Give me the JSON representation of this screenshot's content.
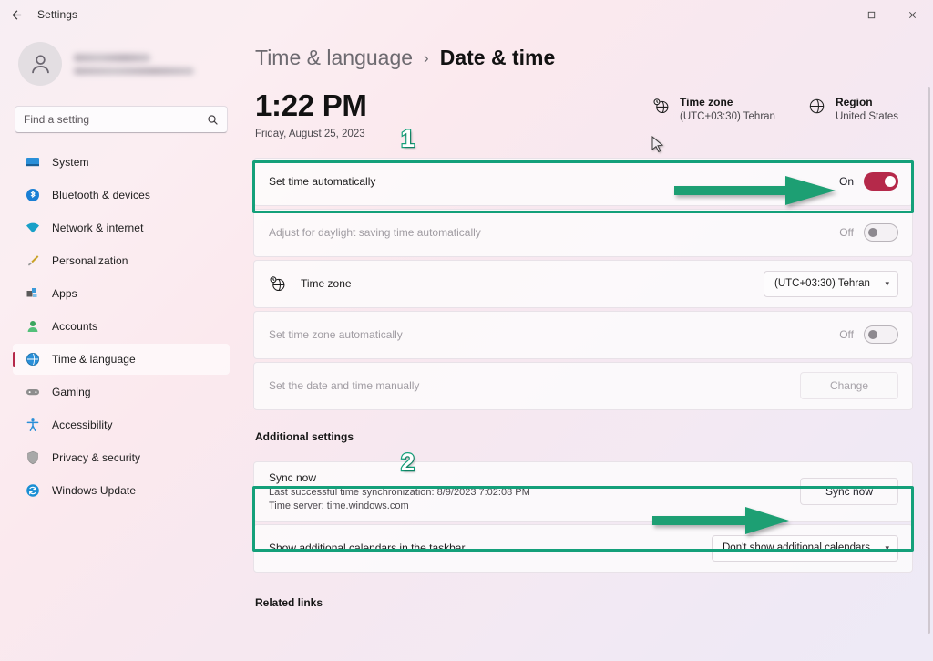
{
  "window": {
    "title": "Settings",
    "back_icon": "back-arrow-icon",
    "minimize_label": "Minimize",
    "maximize_label": "Maximize",
    "close_label": "Close"
  },
  "sidebar": {
    "profile": {
      "name_redacted": "",
      "email_redacted": "",
      "avatar_icon": "person-icon"
    },
    "search": {
      "placeholder": "Find a setting",
      "value": "",
      "icon": "search-icon"
    },
    "items": [
      {
        "label": "System",
        "icon": "monitor-icon",
        "selected": false
      },
      {
        "label": "Bluetooth & devices",
        "icon": "bluetooth-icon",
        "selected": false
      },
      {
        "label": "Network & internet",
        "icon": "wifi-icon",
        "selected": false
      },
      {
        "label": "Personalization",
        "icon": "paintbrush-icon",
        "selected": false
      },
      {
        "label": "Apps",
        "icon": "apps-icon",
        "selected": false
      },
      {
        "label": "Accounts",
        "icon": "account-icon",
        "selected": false
      },
      {
        "label": "Time & language",
        "icon": "clock-globe-icon",
        "selected": true
      },
      {
        "label": "Gaming",
        "icon": "gamepad-icon",
        "selected": false
      },
      {
        "label": "Accessibility",
        "icon": "accessibility-icon",
        "selected": false
      },
      {
        "label": "Privacy & security",
        "icon": "shield-icon",
        "selected": false
      },
      {
        "label": "Windows Update",
        "icon": "update-icon",
        "selected": false
      }
    ]
  },
  "breadcrumb": {
    "parent": "Time & language",
    "separator": "›",
    "current": "Date & time"
  },
  "clock": {
    "time": "1:22 PM",
    "date": "Friday, August 25, 2023"
  },
  "info": {
    "timezone": {
      "icon": "clock-globe-icon",
      "title": "Time zone",
      "value": "(UTC+03:30) Tehran"
    },
    "region": {
      "icon": "globe-icon",
      "title": "Region",
      "value": "United States"
    }
  },
  "settings_rows": {
    "set_time_automatically": {
      "label": "Set time automatically",
      "state_label": "On",
      "toggle_on": true,
      "highlighted": true
    },
    "daylight_saving": {
      "label": "Adjust for daylight saving time automatically",
      "state_label": "Off",
      "toggle_on": false,
      "disabled": true
    },
    "time_zone": {
      "icon": "clock-globe-icon",
      "label": "Time zone",
      "dropdown_value": "(UTC+03:30) Tehran"
    },
    "set_time_zone_automatically": {
      "label": "Set time zone automatically",
      "state_label": "Off",
      "toggle_on": false,
      "disabled": true
    },
    "set_manually": {
      "label": "Set the date and time manually",
      "button_label": "Change",
      "disabled": true
    }
  },
  "additional_settings": {
    "heading": "Additional settings",
    "sync": {
      "title": "Sync now",
      "last_sync": "Last successful time synchronization: 8/9/2023 7:02:08 PM",
      "time_server": "Time server: time.windows.com",
      "button_label": "Sync now",
      "highlighted": true
    },
    "calendars": {
      "label": "Show additional calendars in the taskbar",
      "dropdown_value": "Don't show additional calendars"
    }
  },
  "related_links": {
    "heading": "Related links"
  },
  "annotations": {
    "marker_1": "1",
    "marker_2": "2",
    "highlight_color": "#14a07a",
    "arrow_color": "#1d9f73"
  },
  "colors": {
    "accent": "#b5294a",
    "annotation_green": "#14a07a"
  }
}
